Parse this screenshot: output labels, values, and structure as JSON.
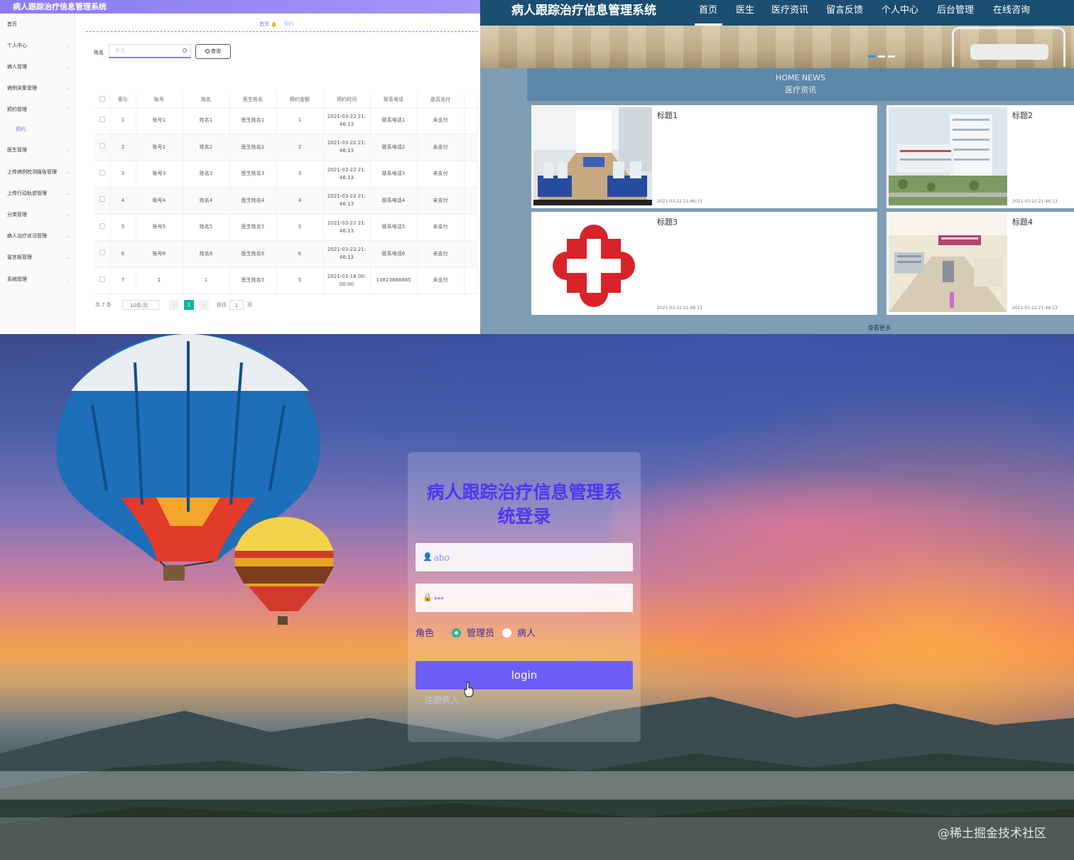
{
  "admin": {
    "header_title": "病人跟踪治疗信息管理系统",
    "sidebar": [
      {
        "label": "首页"
      },
      {
        "label": "个人中心"
      },
      {
        "label": "病人管理"
      },
      {
        "label": "病例采集管理"
      },
      {
        "label": "预约管理"
      },
      {
        "label": "预约"
      },
      {
        "label": "医生管理"
      },
      {
        "label": "上传病例检测报告管理"
      },
      {
        "label": "上传行动轨迹管理"
      },
      {
        "label": "分类管理"
      },
      {
        "label": "病人治疗状况管理"
      },
      {
        "label": "留言板管理"
      },
      {
        "label": "系统管理"
      }
    ],
    "breadcrumb": {
      "home": "首页",
      "current": "预约"
    },
    "search": {
      "label": "姓名",
      "placeholder": "姓名",
      "button": "查询"
    },
    "table": {
      "headers": [
        "索引",
        "账号",
        "姓名",
        "医生姓名",
        "预约金额",
        "预约时间",
        "联系电话",
        "是否支付"
      ],
      "rows": [
        [
          "1",
          "账号1",
          "姓名1",
          "医生姓名1",
          "1",
          "2021-03-22 21:",
          "46:13",
          "联系电话1",
          "未支付"
        ],
        [
          "2",
          "账号2",
          "姓名2",
          "医生姓名2",
          "2",
          "2021-03-22 21:",
          "46:13",
          "联系电话2",
          "未支付"
        ],
        [
          "3",
          "账号3",
          "姓名3",
          "医生姓名3",
          "3",
          "2021-03-22 21:",
          "46:13",
          "联系电话3",
          "未支付"
        ],
        [
          "4",
          "账号4",
          "姓名4",
          "医生姓名4",
          "4",
          "2021-03-22 21:",
          "46:13",
          "联系电话4",
          "未支付"
        ],
        [
          "5",
          "账号5",
          "姓名5",
          "医生姓名5",
          "5",
          "2021-03-22 21:",
          "46:13",
          "联系电话5",
          "未支付"
        ],
        [
          "6",
          "账号6",
          "姓名6",
          "医生姓名6",
          "6",
          "2021-03-22 21:",
          "46:13",
          "联系电话6",
          "未支付"
        ],
        [
          "7",
          "1",
          "1",
          "医生姓名5",
          "5",
          "2021-03-18 00:",
          "00:00",
          "13823888885",
          "未支付"
        ]
      ]
    },
    "pagination": {
      "total": "共 7 条",
      "page_size": "10条/页",
      "current": "1",
      "goto_label": "前往",
      "goto_value": "1",
      "page_unit": "页"
    }
  },
  "front": {
    "logo": "病人跟踪治疗信息管理系统",
    "nav": [
      "首页",
      "医生",
      "医疗资讯",
      "留言反馈",
      "个人中心",
      "后台管理",
      "在线咨询"
    ],
    "news_heading_en": "HOME NEWS",
    "news_heading_cn": "医疗资讯",
    "cards": [
      {
        "title": "标题1",
        "date": "2021-03-22 21:46:13"
      },
      {
        "title": "标题2",
        "date": "2021-03-22 21:46:13"
      },
      {
        "title": "标题3",
        "date": "2021-03-22 21:46:13"
      },
      {
        "title": "标题4",
        "date": "2021-03-22 21:46:13"
      }
    ],
    "more": "查看更多"
  },
  "login": {
    "title": "病人跟踪治疗信息管理系统登录",
    "username_value": "abo",
    "password_value": "•••",
    "role_label": "角色",
    "roles": [
      {
        "label": "管理员",
        "selected": true
      },
      {
        "label": "病人",
        "selected": false
      }
    ],
    "login_button": "login",
    "register": "注册病人",
    "watermark": "@稀土掘金技术社区"
  },
  "colors": {
    "admin_accent": "#8b7cf2",
    "front_nav": "#1b4e70",
    "login_title": "#4f35f2",
    "login_button": "#6d5ff6",
    "page_current": "#10b69a"
  }
}
